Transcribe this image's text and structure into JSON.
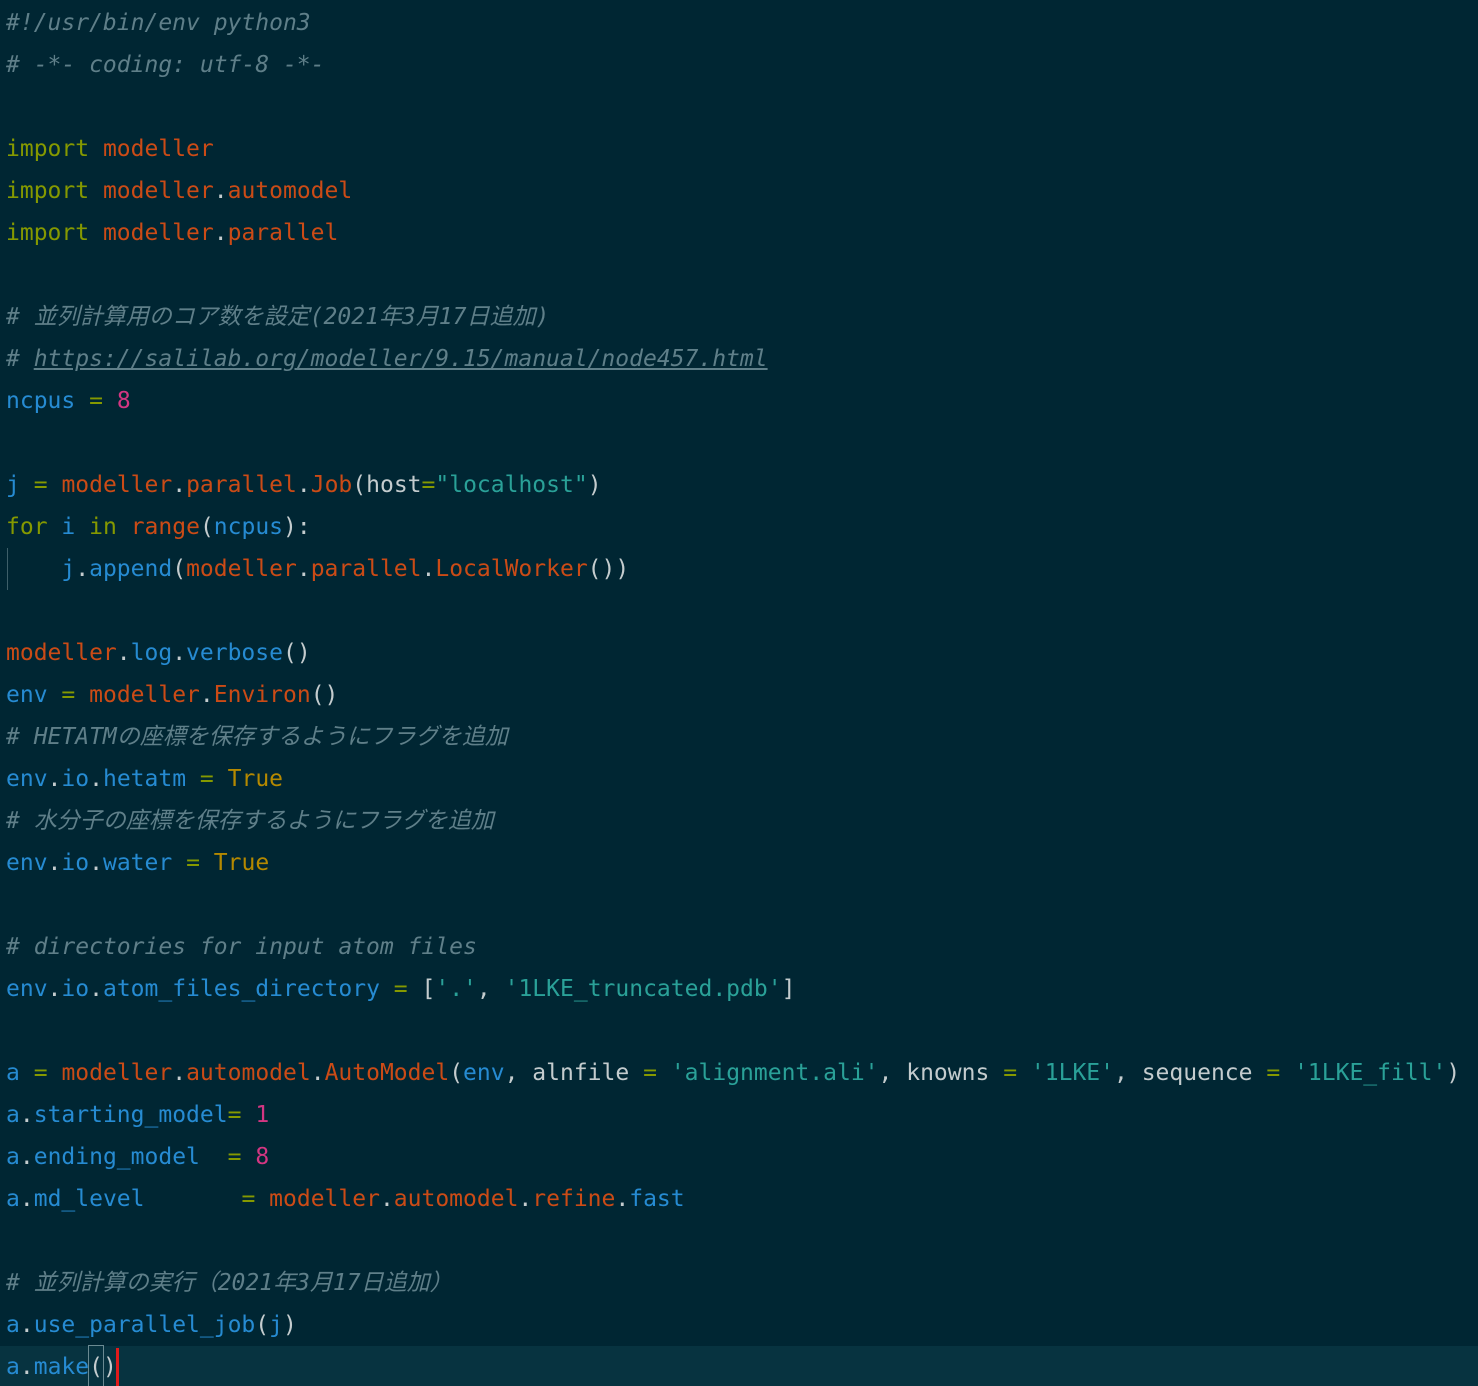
{
  "editor": {
    "language": "python",
    "theme_colors": {
      "background": "#002633",
      "comment": "#5f7f89",
      "keyword": "#859900",
      "module": "#cb4b16",
      "variable": "#268bd2",
      "number": "#d33682",
      "string": "#2aa198",
      "boolean": "#b58900"
    },
    "cursor_line": 33,
    "lines": {
      "l1": "#!/usr/bin/env python3",
      "l2": "# -*- coding: utf-8 -*-",
      "l4_kw": "import",
      "l4_mod": "modeller",
      "l5_kw": "import",
      "l5_mod": "modeller",
      "l5_sub": "automodel",
      "l6_kw": "import",
      "l6_mod": "modeller",
      "l6_sub": "parallel",
      "l8": "# 並列計算用のコア数を設定(2021年3月17日追加)",
      "l9_hash": "# ",
      "l9_url": "https://salilab.org/modeller/9.15/manual/node457.html",
      "l10_var": "ncpus",
      "l10_num": "8",
      "l12_var": "j",
      "l12_mod": "modeller",
      "l12_sub": "parallel",
      "l12_cls": "Job",
      "l12_arg": "host",
      "l12_str": "\"localhost\"",
      "l13_kw1": "for",
      "l13_var": "i",
      "l13_kw2": "in",
      "l13_fn": "range",
      "l13_arg": "ncpus",
      "l14_var": "j",
      "l14_fn": "append",
      "l14_mod": "modeller",
      "l14_sub": "parallel",
      "l14_cls": "LocalWorker",
      "l16_mod": "modeller",
      "l16_a": "log",
      "l16_b": "verbose",
      "l17_var": "env",
      "l17_mod": "modeller",
      "l17_cls": "Environ",
      "l18": "# HETATMの座標を保存するようにフラグを追加",
      "l19_a": "env",
      "l19_b": "io",
      "l19_c": "hetatm",
      "l19_val": "True",
      "l20": "# 水分子の座標を保存するようにフラグを追加",
      "l21_a": "env",
      "l21_b": "io",
      "l21_c": "water",
      "l21_val": "True",
      "l23": "# directories for input atom files",
      "l24_a": "env",
      "l24_b": "io",
      "l24_c": "atom_files_directory",
      "l24_s1": "'.'",
      "l24_s2": "'1LKE_truncated.pdb'",
      "l26_var": "a",
      "l26_mod": "modeller",
      "l26_sub": "automodel",
      "l26_cls": "AutoModel",
      "l26_env": "env",
      "l26_k1": "alnfile",
      "l26_s1": "'alignment.ali'",
      "l26_k2": "knowns",
      "l26_s2": "'1LKE'",
      "l26_k3": "sequence",
      "l26_s3": "'1LKE_fill'",
      "l27_a": "a",
      "l27_b": "starting_model",
      "l27_num": "1",
      "l28_a": "a",
      "l28_b": "ending_model",
      "l28_num": "8",
      "l29_a": "a",
      "l29_b": "md_level",
      "l29_mod": "modeller",
      "l29_sub": "automodel",
      "l29_c": "refine",
      "l29_d": "fast",
      "l31": "# 並列計算の実行（2021年3月17日追加）",
      "l32_a": "a",
      "l32_b": "use_parallel_job",
      "l32_arg": "j",
      "l33_a": "a",
      "l33_b": "make"
    }
  }
}
